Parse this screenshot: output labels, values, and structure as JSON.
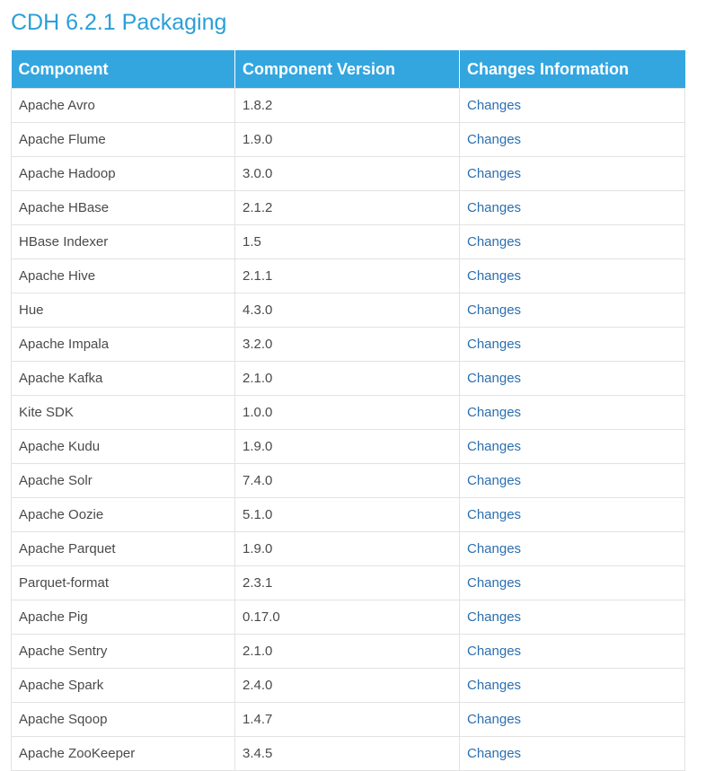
{
  "page": {
    "title": "CDH 6.2.1 Packaging"
  },
  "table": {
    "headers": [
      "Component",
      "Component Version",
      "Changes Information"
    ],
    "rows": [
      {
        "component": "Apache Avro",
        "version": "1.8.2",
        "changes": "Changes"
      },
      {
        "component": "Apache Flume",
        "version": "1.9.0",
        "changes": "Changes"
      },
      {
        "component": "Apache Hadoop",
        "version": "3.0.0",
        "changes": "Changes"
      },
      {
        "component": "Apache HBase",
        "version": "2.1.2",
        "changes": "Changes"
      },
      {
        "component": "HBase Indexer",
        "version": "1.5",
        "changes": "Changes"
      },
      {
        "component": "Apache Hive",
        "version": "2.1.1",
        "changes": "Changes"
      },
      {
        "component": "Hue",
        "version": "4.3.0",
        "changes": "Changes"
      },
      {
        "component": "Apache Impala",
        "version": "3.2.0",
        "changes": "Changes"
      },
      {
        "component": "Apache Kafka",
        "version": "2.1.0",
        "changes": "Changes"
      },
      {
        "component": "Kite SDK",
        "version": "1.0.0",
        "changes": "Changes"
      },
      {
        "component": "Apache Kudu",
        "version": "1.9.0",
        "changes": "Changes"
      },
      {
        "component": "Apache Solr",
        "version": "7.4.0",
        "changes": "Changes"
      },
      {
        "component": "Apache Oozie",
        "version": "5.1.0",
        "changes": "Changes"
      },
      {
        "component": "Apache Parquet",
        "version": "1.9.0",
        "changes": "Changes"
      },
      {
        "component": "Parquet-format",
        "version": "2.3.1",
        "changes": "Changes"
      },
      {
        "component": "Apache Pig",
        "version": "0.17.0",
        "changes": "Changes"
      },
      {
        "component": "Apache Sentry",
        "version": "2.1.0",
        "changes": "Changes"
      },
      {
        "component": "Apache Spark",
        "version": "2.4.0",
        "changes": "Changes"
      },
      {
        "component": "Apache Sqoop",
        "version": "1.4.7",
        "changes": "Changes"
      },
      {
        "component": "Apache ZooKeeper",
        "version": "3.4.5",
        "changes": "Changes"
      }
    ]
  },
  "colors": {
    "title": "#2a9fd8",
    "header_bg": "#33a6e0",
    "link": "#2b6fb0",
    "text": "#4a4a4a",
    "border": "#e2e2e2"
  }
}
